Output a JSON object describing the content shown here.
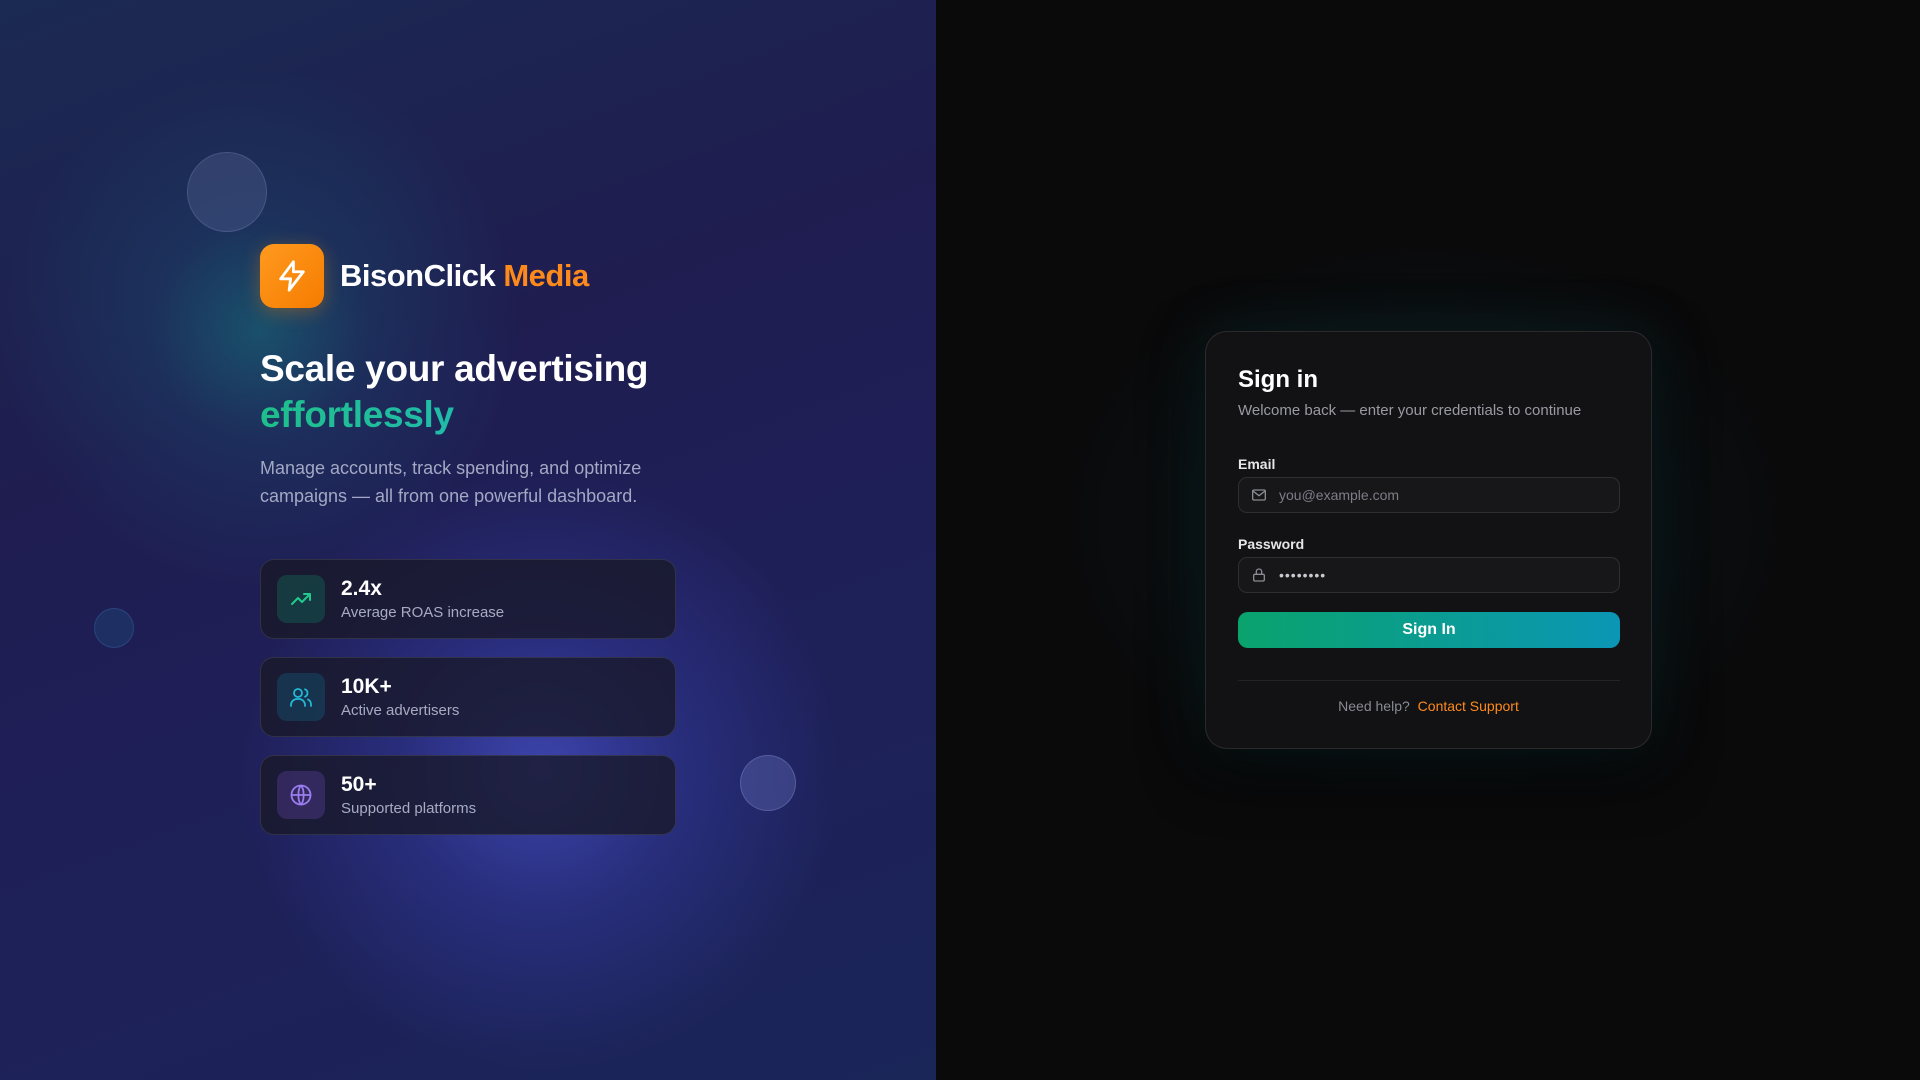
{
  "brand": {
    "name": "BisonClick",
    "accent": "Media",
    "logo_icon": "lightning-bolt-icon",
    "logo_color": "#ff8a1c"
  },
  "hero": {
    "headline": "Scale your advertising",
    "headline_accent": "effortlessly",
    "subtext": "Manage accounts, track spending, and optimize campaigns — all from one powerful dashboard.",
    "accent_color": "#1fbf8a"
  },
  "stats": [
    {
      "value": "2.4x",
      "label": "Average ROAS increase",
      "icon": "trending-up-icon",
      "color": "#22c98d"
    },
    {
      "value": "10K+",
      "label": "Active advertisers",
      "icon": "users-icon",
      "color": "#22b8d6"
    },
    {
      "value": "50+",
      "label": "Supported platforms",
      "icon": "globe-icon",
      "color": "#9b7df0"
    }
  ],
  "signin": {
    "title": "Sign in",
    "subtitle": "Welcome back — enter your credentials to continue",
    "email_label": "Email",
    "email_placeholder": "you@example.com",
    "email_icon": "mail-icon",
    "password_label": "Password",
    "password_value": "••••••••",
    "password_icon": "lock-icon",
    "button_label": "Sign In",
    "help_text": "Need help?",
    "help_link": "Contact Support"
  }
}
